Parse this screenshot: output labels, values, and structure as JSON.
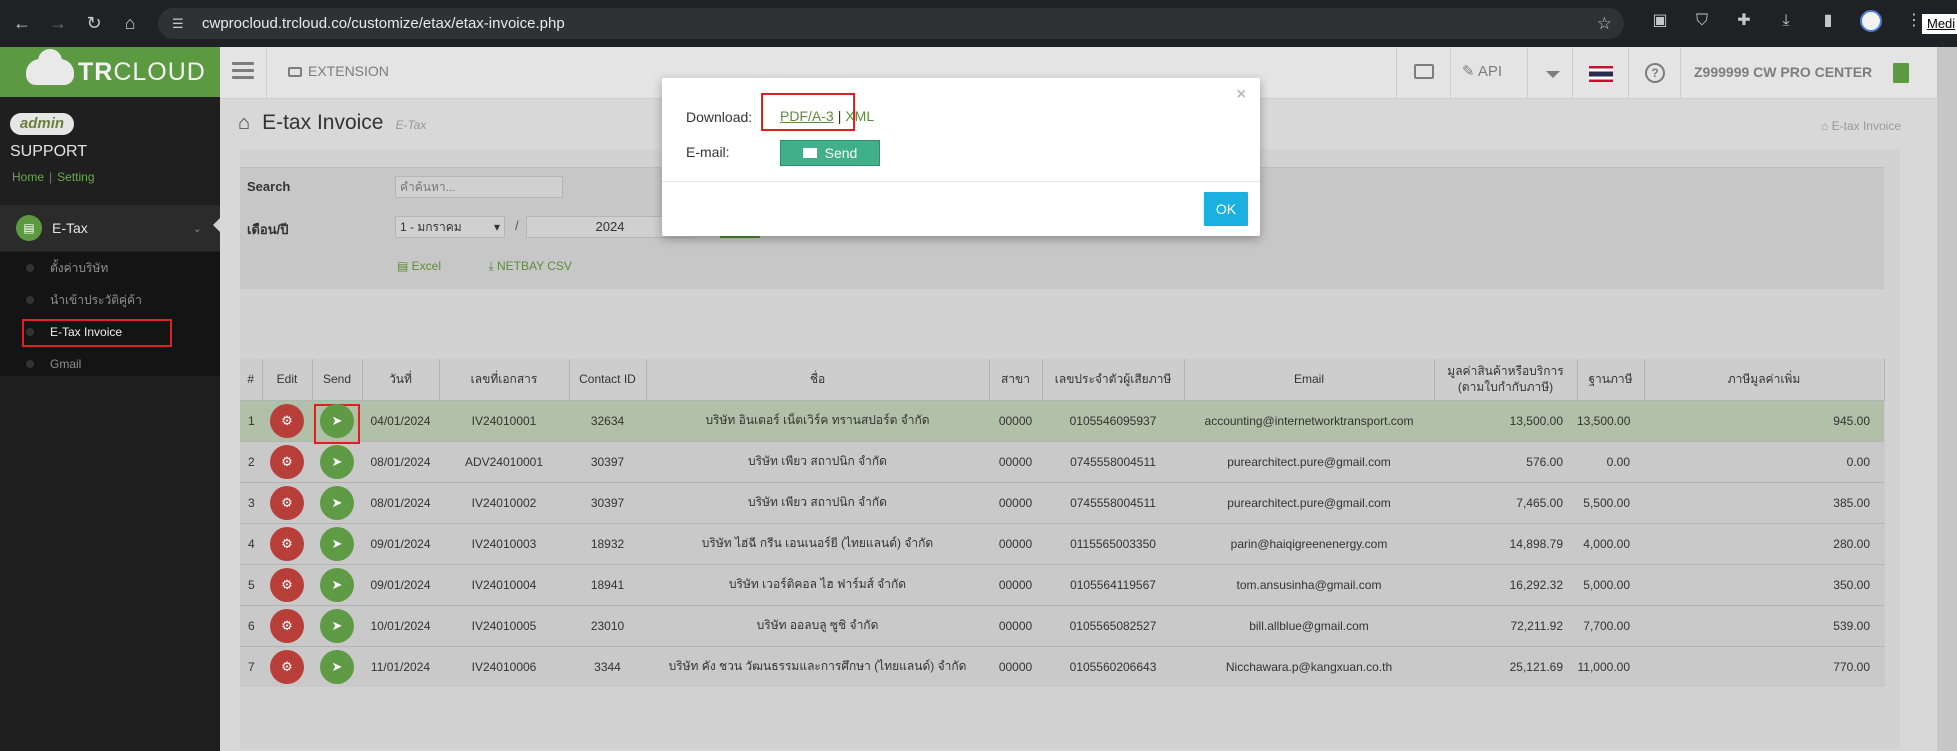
{
  "browser": {
    "url": "cwprocloud.trcloud.co/customize/etax/etax-invoice.php",
    "side_tab": "Medi"
  },
  "sidebar": {
    "logo_bold": "TR",
    "logo_rest": "CLOUD",
    "admin_badge": "admin",
    "support": "SUPPORT",
    "home": "Home",
    "setting": "Setting",
    "sep": "|",
    "menu": "E-Tax",
    "items": [
      {
        "label": "ตั้งค่าบริษัท"
      },
      {
        "label": "นำเข้าประวัติคู่ค้า"
      },
      {
        "label": "E-Tax Invoice"
      },
      {
        "label": "Gmail"
      }
    ]
  },
  "topbar": {
    "extension": "EXTENSION",
    "api": "API",
    "help": "?",
    "company": "Z999999 CW PRO CENTER"
  },
  "page": {
    "title": "E-tax Invoice",
    "subtitle": "E-Tax",
    "breadcrumb": "E-tax Invoice"
  },
  "search": {
    "search_label": "Search",
    "search_placeholder": "คำค้นหา...",
    "month_label": "เดือน/ปี",
    "month_value": "1 - มกราคม",
    "slash": "/",
    "year_value": "2024",
    "excel": "Excel",
    "netbay": "NETBAY CSV"
  },
  "table": {
    "headers": [
      "#",
      "Edit",
      "Send",
      "วันที่",
      "เลขที่เอกสาร",
      "Contact ID",
      "ชื่อ",
      "สาขา",
      "เลขประจำตัวผู้เสียภาษี",
      "Email",
      "มูลค่าสินค้าหรือบริการ (ตามใบกำกับภาษี)",
      "ฐานภาษี",
      "ภาษีมูลค่าเพิ่ม"
    ],
    "rows": [
      {
        "n": "1",
        "date": "04/01/2024",
        "doc": "IV24010001",
        "cid": "32634",
        "name": "บริษัท อินเตอร์ เน็ตเวิร์ค ทรานสปอร์ต จำกัด",
        "branch": "00000",
        "tax": "0105546095937",
        "email": "accounting@internetworktransport.com",
        "value": "13,500.00",
        "base": "13,500.00",
        "vat": "945.00"
      },
      {
        "n": "2",
        "date": "08/01/2024",
        "doc": "ADV24010001",
        "cid": "30397",
        "name": "บริษัท เพียว สถาปนิก จำกัด",
        "branch": "00000",
        "tax": "0745558004511",
        "email": "purearchitect.pure@gmail.com",
        "value": "576.00",
        "base": "0.00",
        "vat": "0.00"
      },
      {
        "n": "3",
        "date": "08/01/2024",
        "doc": "IV24010002",
        "cid": "30397",
        "name": "บริษัท เพียว สถาปนิก จำกัด",
        "branch": "00000",
        "tax": "0745558004511",
        "email": "purearchitect.pure@gmail.com",
        "value": "7,465.00",
        "base": "5,500.00",
        "vat": "385.00"
      },
      {
        "n": "4",
        "date": "09/01/2024",
        "doc": "IV24010003",
        "cid": "18932",
        "name": "บริษัท ไฮ่ฉี กรีน เอนเนอร์ยี (ไทยแลนด์) จำกัด",
        "branch": "00000",
        "tax": "0115565003350",
        "email": "parin@haiqigreenenergy.com",
        "value": "14,898.79",
        "base": "4,000.00",
        "vat": "280.00"
      },
      {
        "n": "5",
        "date": "09/01/2024",
        "doc": "IV24010004",
        "cid": "18941",
        "name": "บริษัท เวอร์ติคอล ไฮ ฟาร์มส์ จำกัด",
        "branch": "00000",
        "tax": "0105564119567",
        "email": "tom.ansusinha@gmail.com",
        "value": "16,292.32",
        "base": "5,000.00",
        "vat": "350.00"
      },
      {
        "n": "6",
        "date": "10/01/2024",
        "doc": "IV24010005",
        "cid": "23010",
        "name": "บริษัท ออลบลู ซูชิ จำกัด",
        "branch": "00000",
        "tax": "0105565082527",
        "email": "bill.allblue@gmail.com",
        "value": "72,211.92",
        "base": "7,700.00",
        "vat": "539.00"
      },
      {
        "n": "7",
        "date": "11/01/2024",
        "doc": "IV24010006",
        "cid": "3344",
        "name": "บริษัท คัง ชวน วัฒนธรรมและการศึกษา (ไทยแลนด์) จำกัด",
        "branch": "00000",
        "tax": "0105560206643",
        "email": "Nicchawara.p@kangxuan.co.th",
        "value": "25,121.69",
        "base": "11,000.00",
        "vat": "770.00"
      }
    ]
  },
  "modal": {
    "close": "×",
    "download_label": "Download:",
    "pdf": "PDF/A-3",
    "sep": "|",
    "xml": "XML",
    "email_label": "E-mail:",
    "send": "Send",
    "ok": "OK"
  }
}
